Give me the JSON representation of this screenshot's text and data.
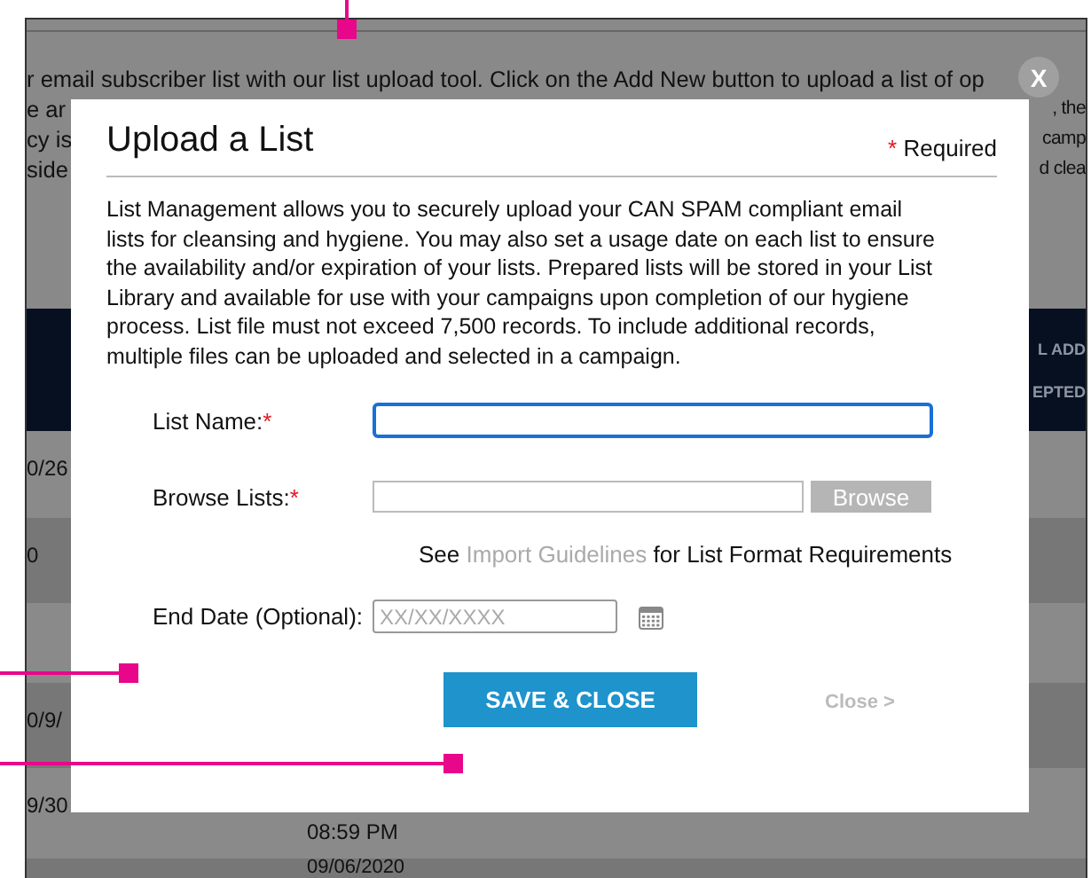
{
  "background_page": {
    "intro_first_line": "r email subscriber list with our list upload tool. Click on the Add New button to upload a list of op",
    "intro_fragments": [
      {
        "left": "e ar",
        "right": ", the"
      },
      {
        "left": "cy is",
        "right": "camp"
      },
      {
        "left": "side",
        "right": "d clea"
      }
    ],
    "header_fragments": [
      "L ADD",
      "EPTED"
    ],
    "rows": [
      {
        "column_1": "0/26"
      },
      {
        "column_1": "0"
      },
      {},
      {
        "column_1": "0/9/"
      },
      {
        "column_1": "9/30",
        "column_2": "08:59 PM"
      },
      {
        "column_2": "09/06/2020"
      }
    ]
  },
  "modal": {
    "close_label": "X",
    "title": "Upload a List",
    "required_mark": "*",
    "required_label": "Required",
    "description": "List Management allows you to securely upload your CAN SPAM compliant email lists for cleansing and hygiene. You may also set a usage date on each list to ensure the availability and/or expiration of your lists. Prepared lists will be stored in your List Library and available for use with your campaigns upon completion of our hygiene process. List file must not exceed 7,500 records. To include additional records, multiple files can be uploaded and selected in a campaign.",
    "fields": [
      {
        "kind": "text",
        "label": "List Name:",
        "required_mark": "*",
        "focused": true
      },
      {
        "kind": "file",
        "label": "Browse Lists:",
        "required_mark": "*",
        "button": "Browse"
      },
      {
        "kind": "date",
        "label": "End Date (Optional):",
        "placeholder": "XX/XX/XXXX"
      }
    ],
    "guidelines": {
      "before": "See",
      "link": "Import Guidelines",
      "after": "for List Format Requirements"
    },
    "save_button": "SAVE & CLOSE",
    "close_link": "Close >"
  }
}
